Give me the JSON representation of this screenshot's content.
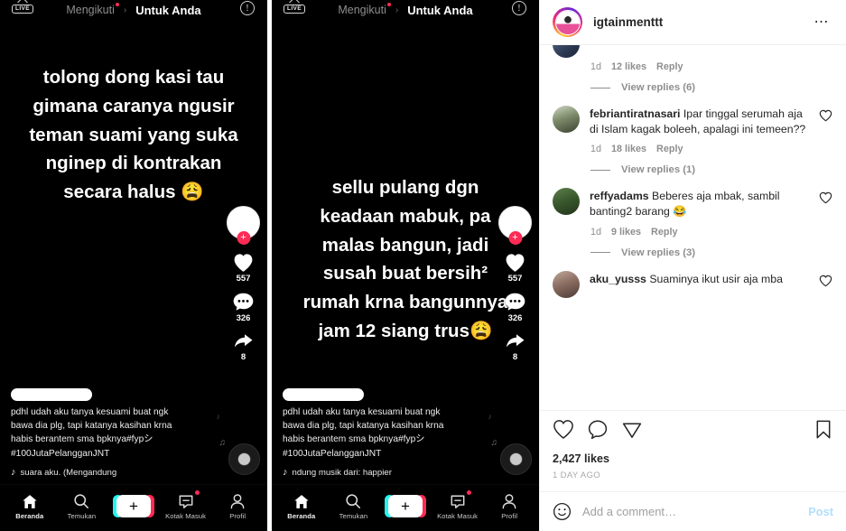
{
  "tiktok": {
    "header": {
      "live_label": "LIVE",
      "tab_following": "Mengikuti",
      "tab_separator": "›",
      "tab_foryou": "Untuk Anda",
      "warning_icon": "exclamation-circle-icon"
    },
    "nav": [
      {
        "label": "Beranda",
        "icon": "home-icon"
      },
      {
        "label": "Temukan",
        "icon": "search-icon"
      },
      {
        "label": "+",
        "icon": "create-icon"
      },
      {
        "label": "Kotak Masuk",
        "icon": "inbox-icon"
      },
      {
        "label": "Profil",
        "icon": "profile-icon"
      }
    ],
    "rail": {
      "follow_badge": "+",
      "like_count": "557",
      "comment_count": "326",
      "share_count": "8"
    },
    "caption": {
      "line1": "pdhl udah aku tanya kesuami buat ngk",
      "line2": "bawa dia plg, tapi katanya kasihan krna",
      "line3": "habis berantem sma bpknya#fypシ",
      "line4": "#100JutaPelangganJNT"
    },
    "panel1": {
      "overlay": [
        "tolong dong kasi tau",
        "gimana caranya ngusir",
        "teman suami yang suka",
        "nginep di kontrakan",
        "secara halus 😩"
      ],
      "music": "suara aku. (Mengandung"
    },
    "panel2": {
      "overlay": [
        "sellu pulang dgn",
        "keadaan mabuk, pa",
        "malas bangun, jadi",
        "susah buat bersih²",
        "rumah krna bangunnya",
        "jam 12 siang trus😩"
      ],
      "music": "ndung musik dari: happier"
    }
  },
  "instagram": {
    "header": {
      "username": "igtainmenttt",
      "more_icon": "more-options-icon"
    },
    "top_partial_comment": {
      "time": "1d",
      "likes": "12 likes",
      "reply": "Reply",
      "view_replies": "View replies (6)"
    },
    "comments": [
      {
        "username": "febriantiratnasari",
        "text": " Ipar tinggal serumah aja di Islam kagak boleeh, apalagi ini temeen??",
        "time": "1d",
        "likes": "18 likes",
        "reply": "Reply",
        "view_replies": "View replies (1)"
      },
      {
        "username": "reffyadams",
        "text": " Beberes aja mbak, sambil banting2 barang 😂",
        "time": "1d",
        "likes": "9 likes",
        "reply": "Reply",
        "view_replies": "View replies (3)"
      },
      {
        "username": "aku_yusss",
        "text": " Suaminya ikut usir aja mba",
        "time": "",
        "likes": "",
        "reply": "",
        "view_replies": ""
      }
    ],
    "actions": {
      "like_icon": "heart-icon",
      "comment_icon": "comment-icon",
      "share_icon": "share-paperplane-icon",
      "save_icon": "bookmark-icon",
      "likes": "2,427 likes",
      "timestamp": "1 DAY AGO"
    },
    "add_comment": {
      "emoji_icon": "smiley-icon",
      "placeholder": "Add a comment…",
      "value": "",
      "post_label": "Post"
    }
  }
}
